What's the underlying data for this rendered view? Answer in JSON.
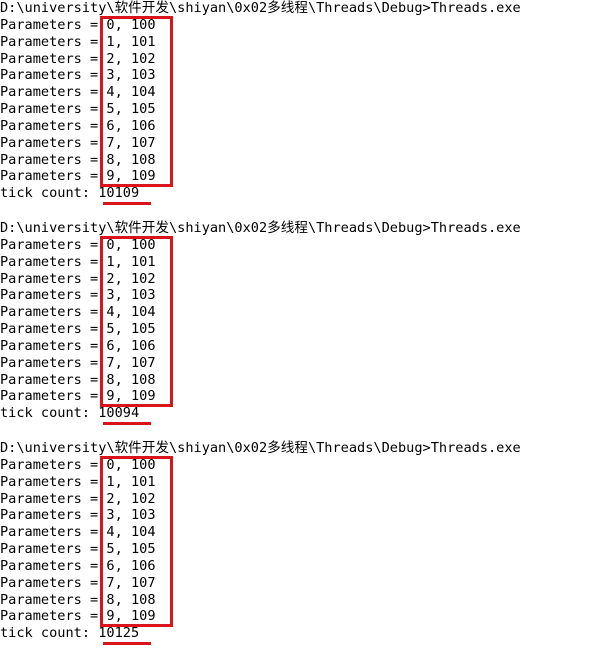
{
  "runs": [
    {
      "prompt": "D:\\university\\软件开发\\shiyan\\0x02多线程\\Threads\\Debug>Threads.exe",
      "lines": [
        "Parameters = 0, 100",
        "Parameters = 1, 101",
        "Parameters = 2, 102",
        "Parameters = 3, 103",
        "Parameters = 4, 104",
        "Parameters = 5, 105",
        "Parameters = 6, 106",
        "Parameters = 7, 107",
        "Parameters = 8, 108",
        "Parameters = 9, 109"
      ],
      "tick": "tick count: 10109"
    },
    {
      "prompt": "D:\\university\\软件开发\\shiyan\\0x02多线程\\Threads\\Debug>Threads.exe",
      "lines": [
        "Parameters = 0, 100",
        "Parameters = 1, 101",
        "Parameters = 2, 102",
        "Parameters = 3, 103",
        "Parameters = 4, 104",
        "Parameters = 5, 105",
        "Parameters = 6, 106",
        "Parameters = 7, 107",
        "Parameters = 8, 108",
        "Parameters = 9, 109"
      ],
      "tick": "tick count: 10094"
    },
    {
      "prompt": "D:\\university\\软件开发\\shiyan\\0x02多线程\\Threads\\Debug>Threads.exe",
      "lines": [
        "Parameters = 0, 100",
        "Parameters = 1, 101",
        "Parameters = 2, 102",
        "Parameters = 3, 103",
        "Parameters = 4, 104",
        "Parameters = 5, 105",
        "Parameters = 6, 106",
        "Parameters = 7, 107",
        "Parameters = 8, 108",
        "Parameters = 9, 109"
      ],
      "tick": "tick count: 10125"
    }
  ],
  "colors": {
    "highlight": "#d9141b",
    "text": "#000000",
    "background": "#ffffff"
  }
}
